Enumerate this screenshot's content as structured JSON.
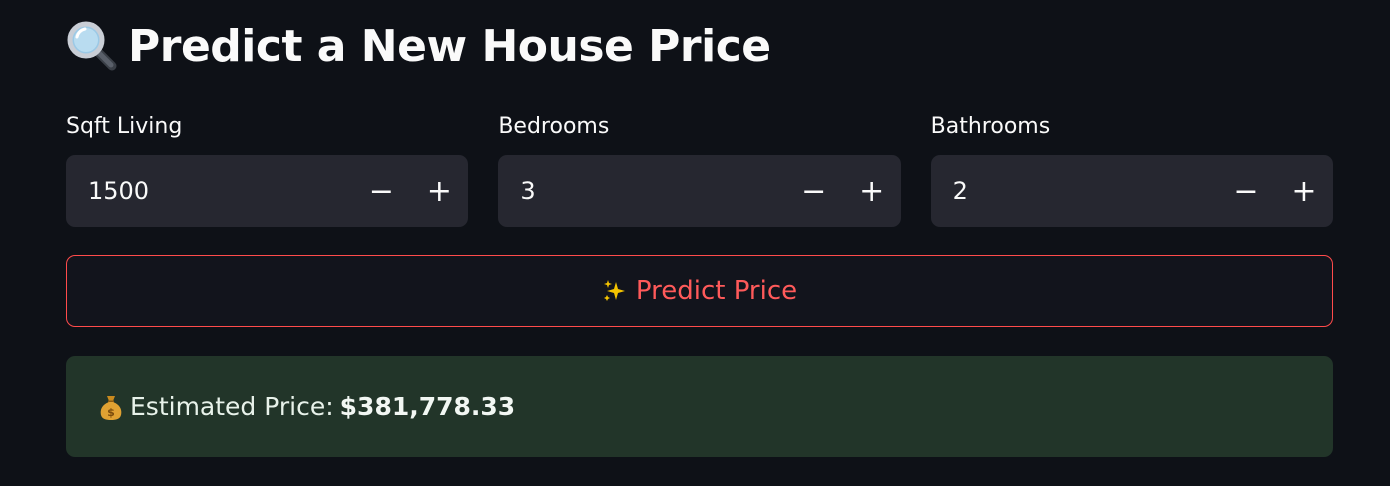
{
  "header": {
    "title": "Predict a New House Price",
    "icon": "magnifying-glass-icon"
  },
  "inputs": [
    {
      "label": "Sqft Living",
      "value": "1500",
      "minus": "−",
      "plus": "+"
    },
    {
      "label": "Bedrooms",
      "value": "3",
      "minus": "−",
      "plus": "+"
    },
    {
      "label": "Bathrooms",
      "value": "2",
      "minus": "−",
      "plus": "+"
    }
  ],
  "predict_button": {
    "icon": "sparkles-icon",
    "label": "Predict Price"
  },
  "result": {
    "icon": "money-bag-icon",
    "prefix": "Estimated Price:",
    "value": "$381,778.33"
  },
  "colors": {
    "background": "#0e1117",
    "input_bg": "#262730",
    "accent": "#ff4b4b",
    "success_bg": "#223529"
  }
}
